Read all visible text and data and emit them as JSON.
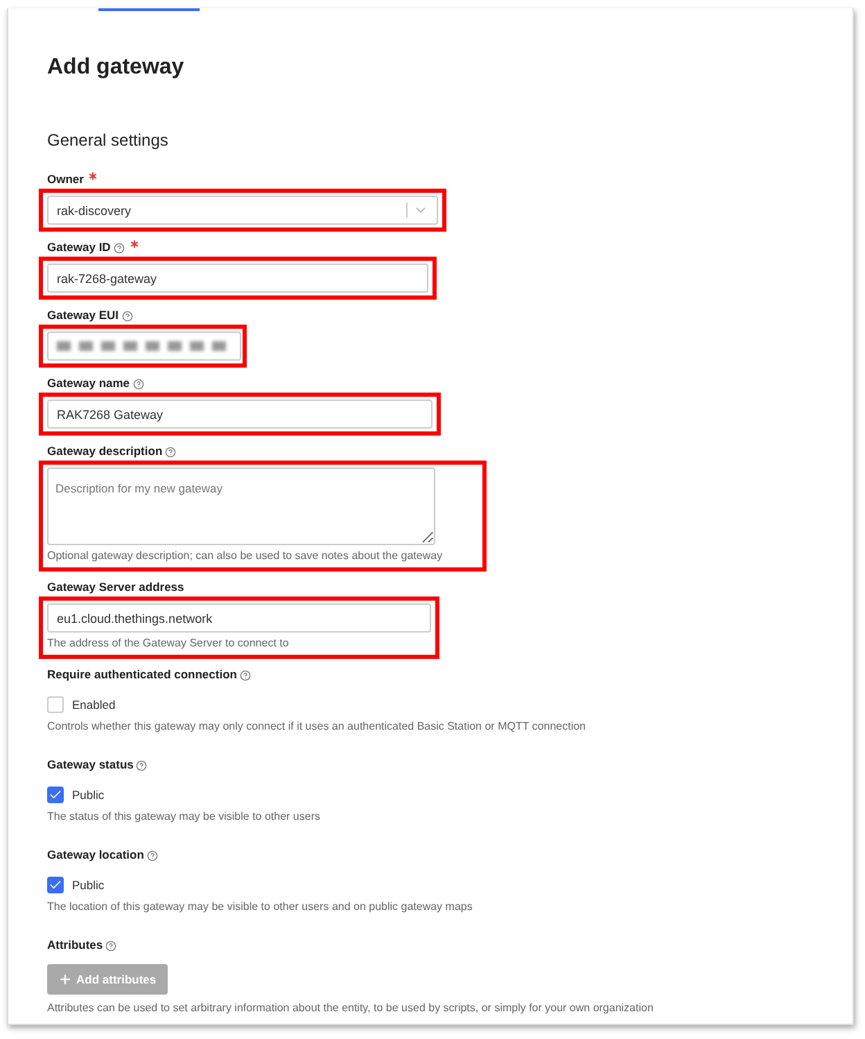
{
  "page": {
    "title": "Add gateway",
    "section": "General settings"
  },
  "fields": [
    {
      "kind": "select",
      "label": "Owner",
      "help": false,
      "required": true,
      "highlighted": true,
      "value": "rak-discovery"
    },
    {
      "kind": "text",
      "label": "Gateway ID",
      "help": true,
      "required": true,
      "highlighted": true,
      "value": "rak-7268-gateway"
    },
    {
      "kind": "redacted",
      "label": "Gateway EUI",
      "help": true,
      "required": false,
      "highlighted": true
    },
    {
      "kind": "text",
      "label": "Gateway name",
      "help": true,
      "required": false,
      "highlighted": true,
      "value": "RAK7268 Gateway"
    },
    {
      "kind": "textarea",
      "label": "Gateway description",
      "help": true,
      "required": false,
      "highlighted": true,
      "placeholder": "Description for my new gateway",
      "description": "Optional gateway description; can also be used to save notes about the gateway"
    },
    {
      "kind": "text",
      "label": "Gateway Server address",
      "help": false,
      "required": false,
      "highlighted": true,
      "value": "eu1.cloud.thethings.network",
      "description": "The address of the Gateway Server to connect to"
    },
    {
      "kind": "checkbox",
      "label": "Require authenticated connection",
      "help": true,
      "required": false,
      "option": "Enabled",
      "checked": false,
      "description": "Controls whether this gateway may only connect if it uses an authenticated Basic Station or MQTT connection"
    },
    {
      "kind": "checkbox",
      "label": "Gateway status",
      "help": true,
      "required": false,
      "option": "Public",
      "checked": true,
      "description": "The status of this gateway may be visible to other users"
    },
    {
      "kind": "checkbox",
      "label": "Gateway location",
      "help": true,
      "required": false,
      "option": "Public",
      "checked": true,
      "description": "The location of this gateway may be visible to other users and on public gateway maps"
    },
    {
      "kind": "button",
      "label": "Attributes",
      "help": true,
      "required": false,
      "button": "Add attributes",
      "description": "Attributes can be used to set arbitrary information about the entity, to be used by scripts, or simply for your own organization"
    }
  ]
}
